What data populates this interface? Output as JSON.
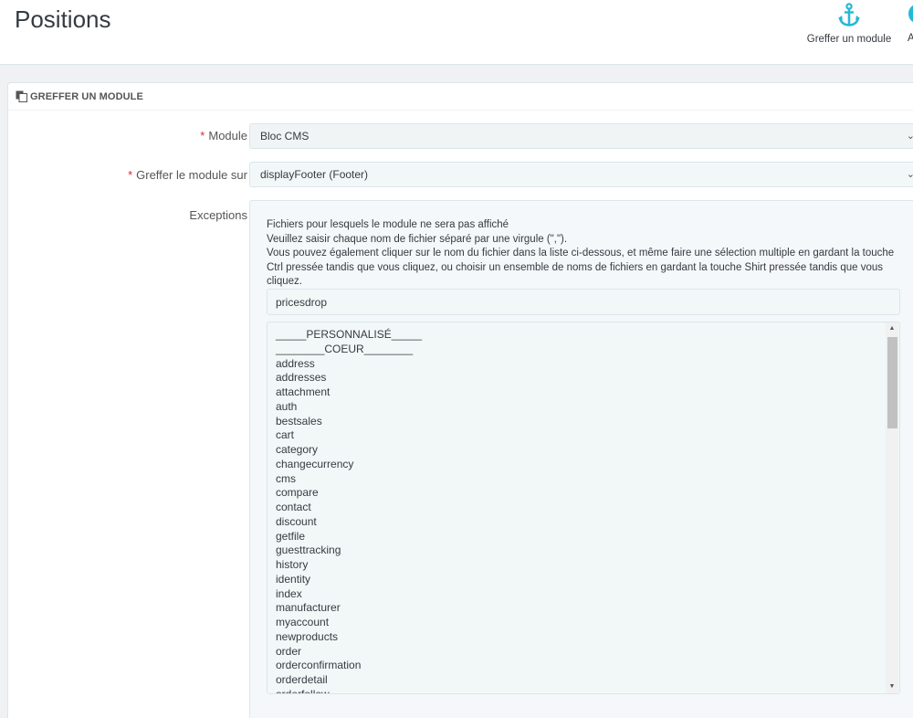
{
  "header": {
    "title": "Positions",
    "graft_label": "Greffer un module",
    "next_label_cut": "A"
  },
  "panel": {
    "title": "GREFFER UN MODULE"
  },
  "form": {
    "module_label": "Module",
    "module_value": "Bloc CMS",
    "hook_label": "Greffer le module sur",
    "hook_value": "displayFooter (Footer)",
    "exceptions_label": "Exceptions",
    "required_mark": "*",
    "help_line1": "Fichiers pour lesquels le module ne sera pas affiché",
    "help_line2": "Veuillez saisir chaque nom de fichier séparé par une virgule (\",\").",
    "help_line3": "Vous pouvez également cliquer sur le nom du fichier dans la liste ci-dessous, et même faire une sélection multiple en gardant la touche Ctrl pressée tandis que vous cliquez, ou choisir un ensemble de noms de fichiers en gardant la touche Shirt pressée tandis que vous cliquez.",
    "exceptions_value": "pricesdrop",
    "files": [
      "_____PERSONNALISÉ_____",
      "________COEUR________",
      "address",
      "addresses",
      "attachment",
      "auth",
      "bestsales",
      "cart",
      "category",
      "changecurrency",
      "cms",
      "compare",
      "contact",
      "discount",
      "getfile",
      "guesttracking",
      "history",
      "identity",
      "index",
      "manufacturer",
      "myaccount",
      "newproducts",
      "order",
      "orderconfirmation",
      "orderdetail",
      "orderfollow"
    ]
  },
  "colors": {
    "accent": "#25b9d7",
    "required": "#e0262f"
  }
}
